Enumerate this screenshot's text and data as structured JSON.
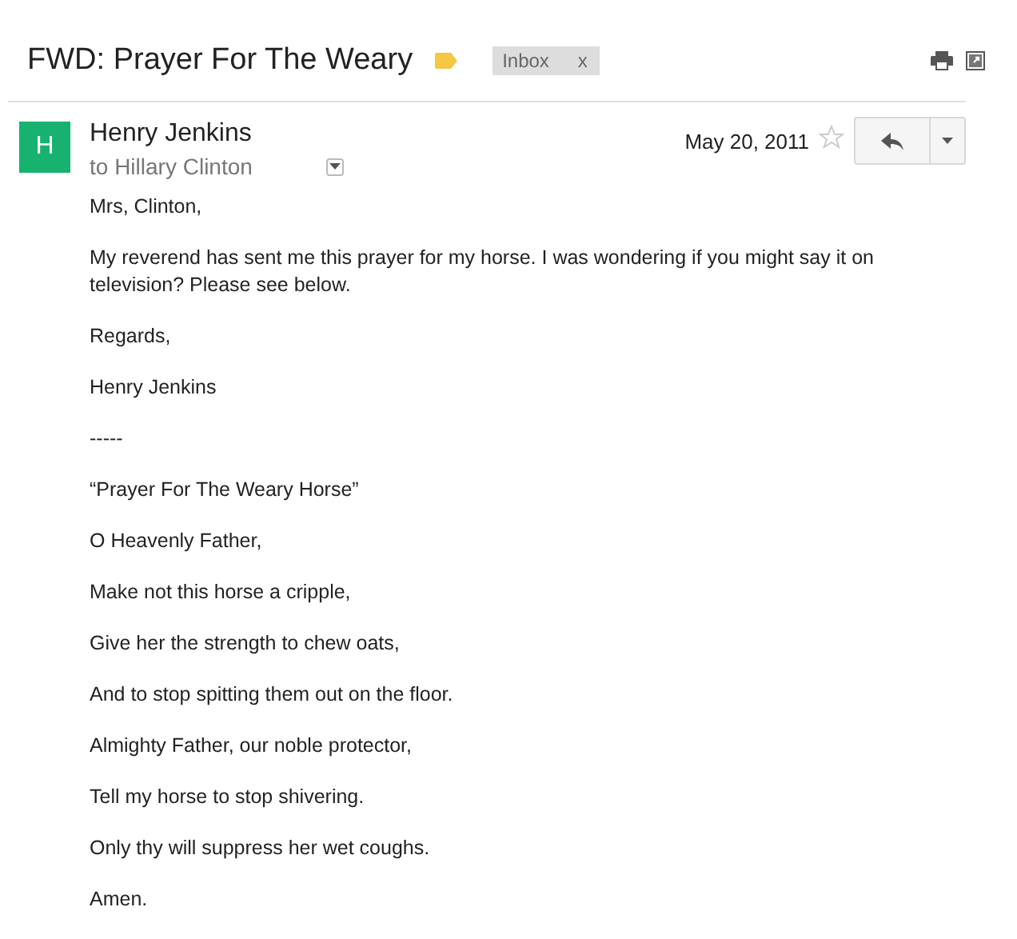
{
  "subject": "FWD: Prayer For The Weary",
  "labels": [
    {
      "text": "Inbox",
      "remove": "x"
    }
  ],
  "message": {
    "avatar_letter": "H",
    "sender": "Henry Jenkins",
    "recipient": "to Hillary Clinton",
    "date": "May 20, 2011",
    "starred": false,
    "body": [
      "Mrs, Clinton,",
      "My reverend has sent me this prayer for my horse. I was wondering if you might say it on television? Please see below.",
      "Regards,",
      "Henry Jenkins",
      "-----",
      "“Prayer For The Weary Horse”",
      "O Heavenly Father,",
      "Make not this horse a cripple,",
      "Give her the strength to chew oats,",
      "And to stop spitting them out on the floor.",
      "Almighty Father, our noble protector,",
      "Tell my horse to stop shivering.",
      "Only thy will suppress her wet coughs.",
      "Amen."
    ]
  }
}
